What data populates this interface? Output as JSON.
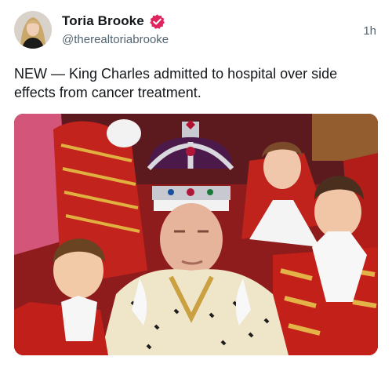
{
  "post": {
    "author": {
      "display_name": "Toria Brooke",
      "handle": "@therealtoriabrooke",
      "verified_icon": "verified-badge-icon",
      "verified_color": "#e0245e"
    },
    "timestamp": "1h",
    "text": "NEW — King Charles admitted to hospital over side effects from cancer treatment.",
    "media": {
      "alt_kind": "photo"
    }
  }
}
